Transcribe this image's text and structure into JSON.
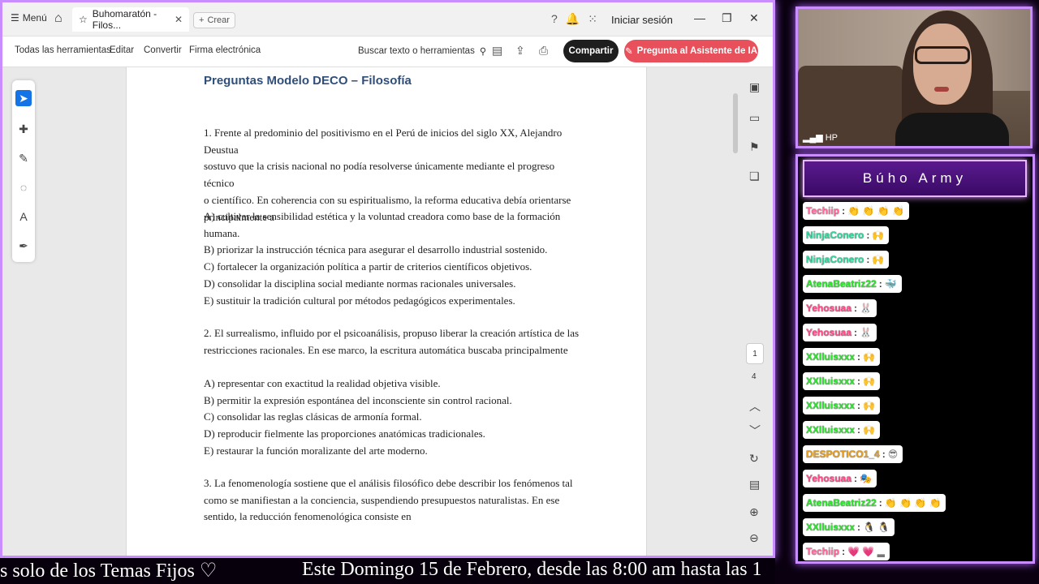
{
  "acrobat": {
    "menu_label": "Menú",
    "tab_title": "Buhomaratón - Filos...",
    "create_label": "Crear",
    "signin_label": "Iniciar sesión",
    "toolbar": {
      "all_tools": "Todas las herramientas",
      "edit": "Editar",
      "convert": "Convertir",
      "esign": "Firma electrónica",
      "search": "Buscar texto o herramientas",
      "share": "Compartir",
      "ai": "Pregunta al Asistente de IA"
    },
    "page_current": "1",
    "page_total": "4"
  },
  "document": {
    "title": "Preguntas Modelo DECO – Filosofía",
    "q1": "1. Frente al predominio del positivismo en el Perú de inicios del siglo XX, Alejandro Deustua\nsostuvo que la crisis nacional no podía resolverse únicamente mediante el progreso técnico\no científico. En coherencia con su espiritualismo, la reforma educativa debía orientarse\nprincipalmente a",
    "q1_options": "A) cultivar la sensibilidad estética y la voluntad creadora como base de la formación\nhumana.\nB) priorizar la instrucción técnica para asegurar el desarrollo industrial sostenido.\nC) fortalecer la organización política a partir de criterios científicos objetivos.\nD) consolidar la disciplina social mediante normas racionales universales.\nE) sustituir la tradición cultural por métodos pedagógicos experimentales.",
    "q2": "2. El surrealismo, influido por el psicoanálisis, propuso liberar la creación artística de las\nrestricciones racionales. En ese marco, la escritura automática buscaba principalmente",
    "q2_options": "A) representar con exactitud la realidad objetiva visible.\nB) permitir la expresión espontánea del inconsciente sin control racional.\nC) consolidar las reglas clásicas de armonía formal.\nD) reproducir fielmente las proporciones anatómicas tradicionales.\nE) restaurar la función moralizante del arte moderno.",
    "q3": "3. La fenomenología sostiene que el análisis filosófico debe describir los fenómenos tal\ncomo se manifiestan a la conciencia, suspendiendo presupuestos naturalistas. En ese\nsentido, la reducción fenomenológica consiste en"
  },
  "ticker": {
    "left": "s solo de los Temas Fijos ♡",
    "right": "Este Domingo 15 de Febrero, desde las 8:00 am hasta las 1"
  },
  "webcam": {
    "label": "HP"
  },
  "chat": {
    "title": "Búho Army",
    "messages": [
      {
        "user": "Techiip",
        "color": "#ff6fa0",
        "emotes": "👏 👏 👏 👏"
      },
      {
        "user": "NinjaConero",
        "color": "#3ad6a0",
        "emotes": "🙌"
      },
      {
        "user": "NinjaConero",
        "color": "#3ad6a0",
        "emotes": "🙌"
      },
      {
        "user": "AtenaBeatriz22",
        "color": "#2ee62e",
        "emotes": "🐳"
      },
      {
        "user": "Yehosuaa",
        "color": "#ff4f8a",
        "emotes": "🐰"
      },
      {
        "user": "Yehosuaa",
        "color": "#ff4f8a",
        "emotes": "🐰"
      },
      {
        "user": "XXlluisxxx",
        "color": "#2ee62e",
        "emotes": "🙌"
      },
      {
        "user": "XXlluisxxx",
        "color": "#2ee62e",
        "emotes": "🙌"
      },
      {
        "user": "XXlluisxxx",
        "color": "#2ee62e",
        "emotes": "🙌"
      },
      {
        "user": "XXlluisxxx",
        "color": "#2ee62e",
        "emotes": "🙌"
      },
      {
        "user": "DESPOTICO1_4",
        "color": "#e8a020",
        "emotes": "😎"
      },
      {
        "user": "Yehosuaa",
        "color": "#ff4f8a",
        "emotes": "🎭"
      },
      {
        "user": "AtenaBeatriz22",
        "color": "#2ee62e",
        "emotes": "👏 👏 👏 👏"
      },
      {
        "user": "XXlluisxxx",
        "color": "#2ee62e",
        "emotes": "🐧 🐧"
      },
      {
        "user": "Techiip",
        "color": "#ff6fa0",
        "emotes": "💗 💗 ▂"
      }
    ]
  }
}
